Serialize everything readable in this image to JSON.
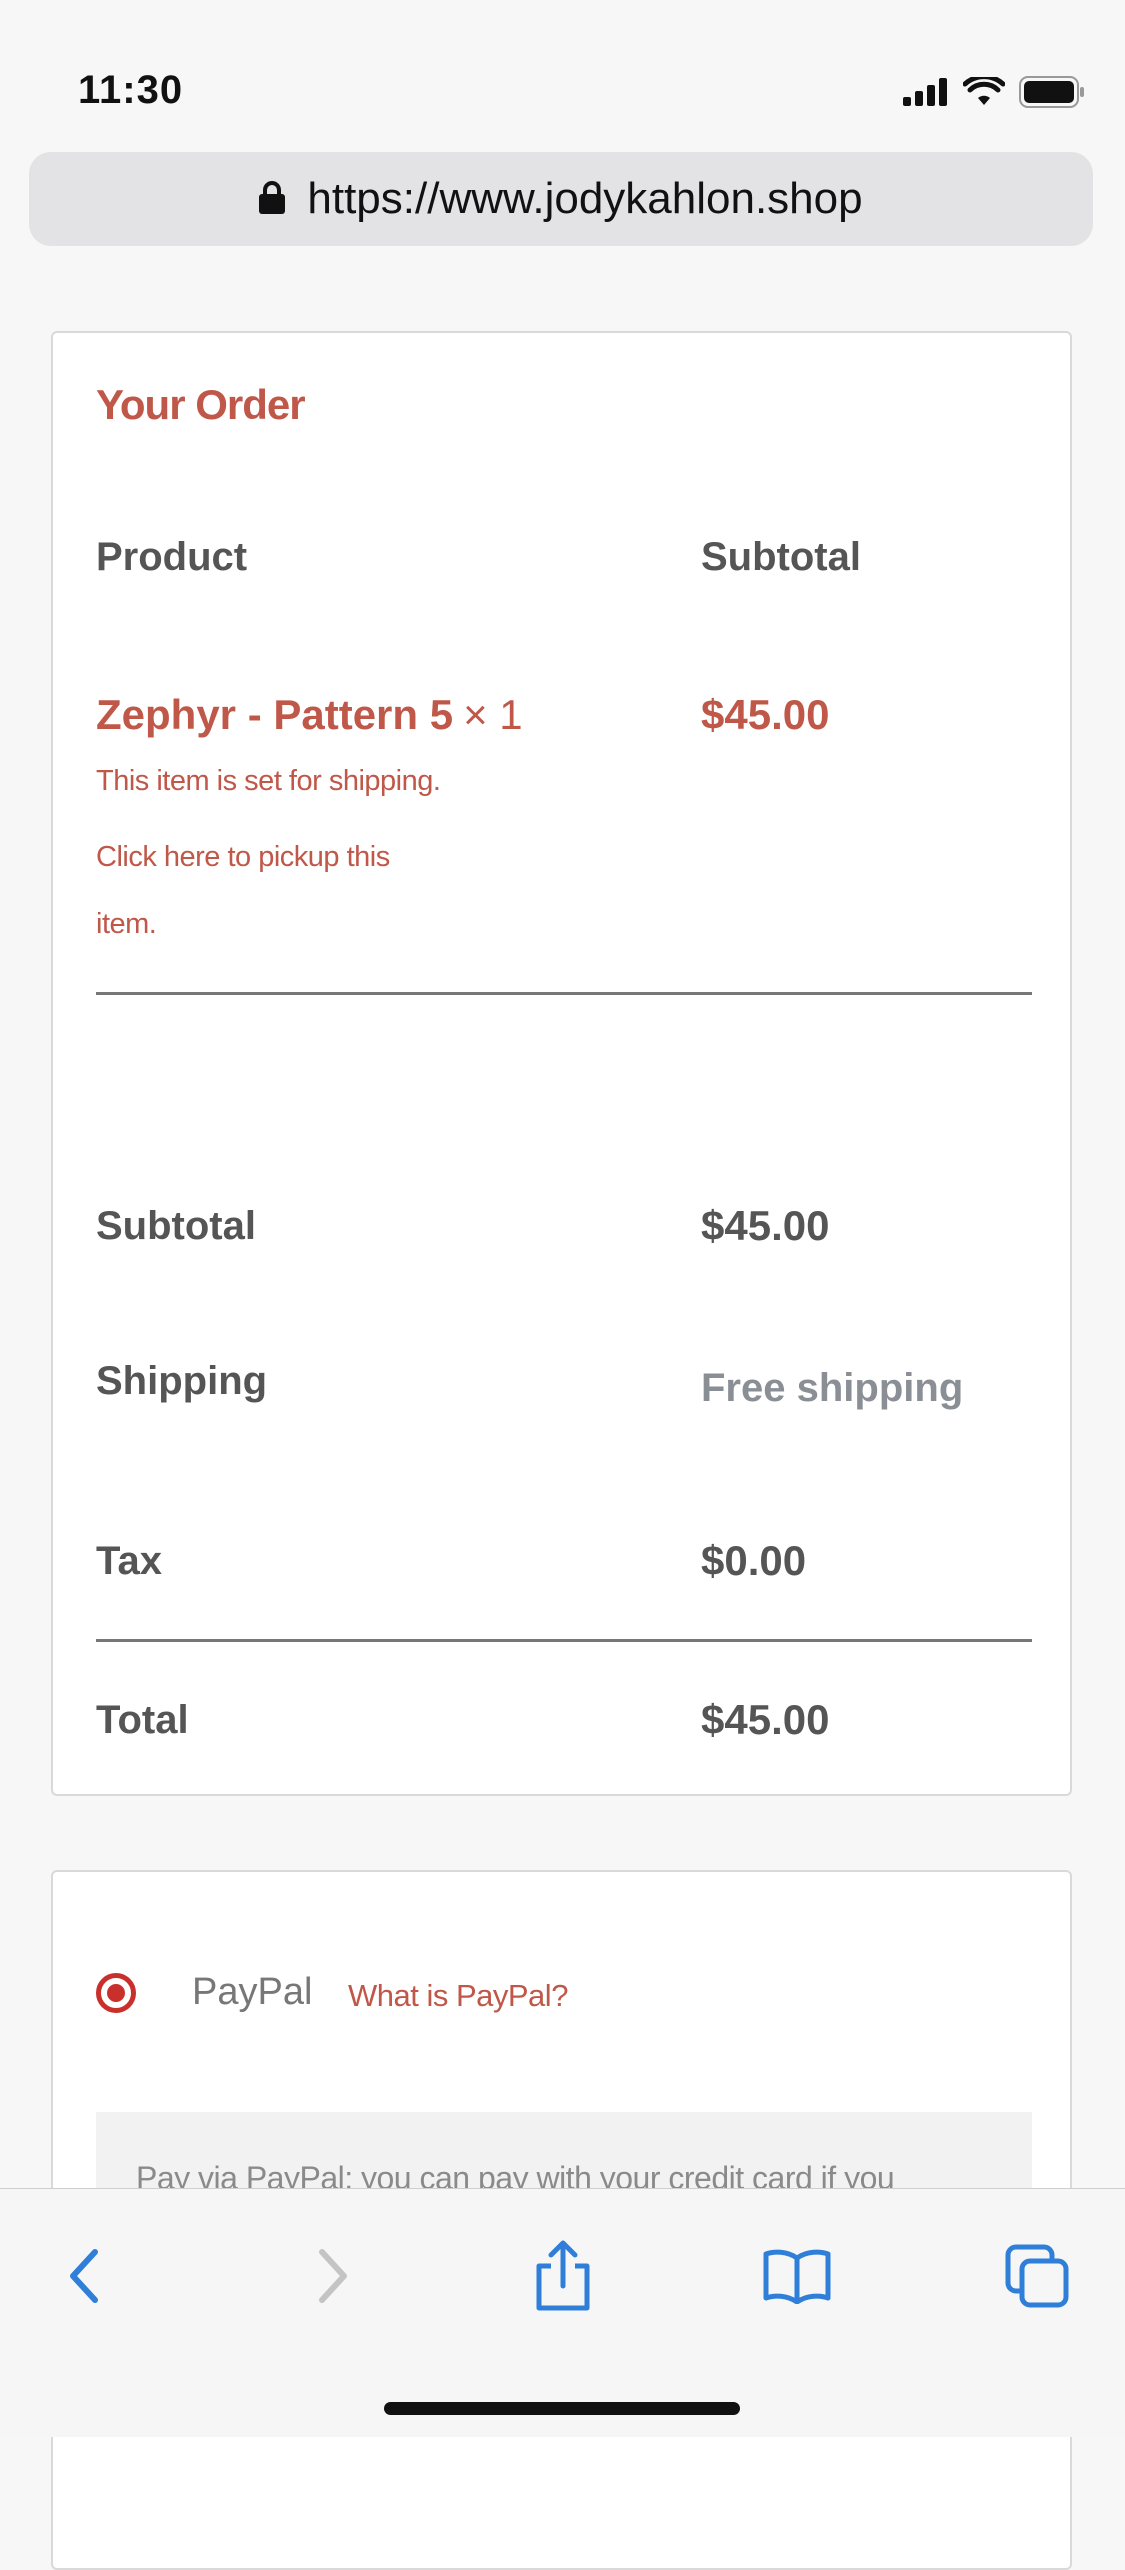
{
  "status_bar": {
    "time": "11:30"
  },
  "browser": {
    "url": "https://www.jodykahlon.shop"
  },
  "order": {
    "title": "Your Order",
    "columns": {
      "product": "Product",
      "subtotal": "Subtotal"
    },
    "item": {
      "name": "Zephyr - Pattern 5",
      "quantity": "× 1",
      "price": "$45.00",
      "shipping_note": "This item is set for shipping.",
      "pickup_link": "Click here to pickup this item."
    },
    "summary": {
      "subtotal_label": "Subtotal",
      "subtotal_value": "$45.00",
      "shipping_label": "Shipping",
      "shipping_value": "Free shipping",
      "tax_label": "Tax",
      "tax_value": "$0.00",
      "total_label": "Total",
      "total_value": "$45.00"
    }
  },
  "payment": {
    "method_label": "PayPal",
    "what_is_link": "What is PayPal?",
    "description": "Pay via PayPal; you can pay with your credit card if you"
  },
  "colors": {
    "accent": "#c0584a",
    "radio": "#c9302c",
    "ios_blue": "#2f7fd9"
  }
}
